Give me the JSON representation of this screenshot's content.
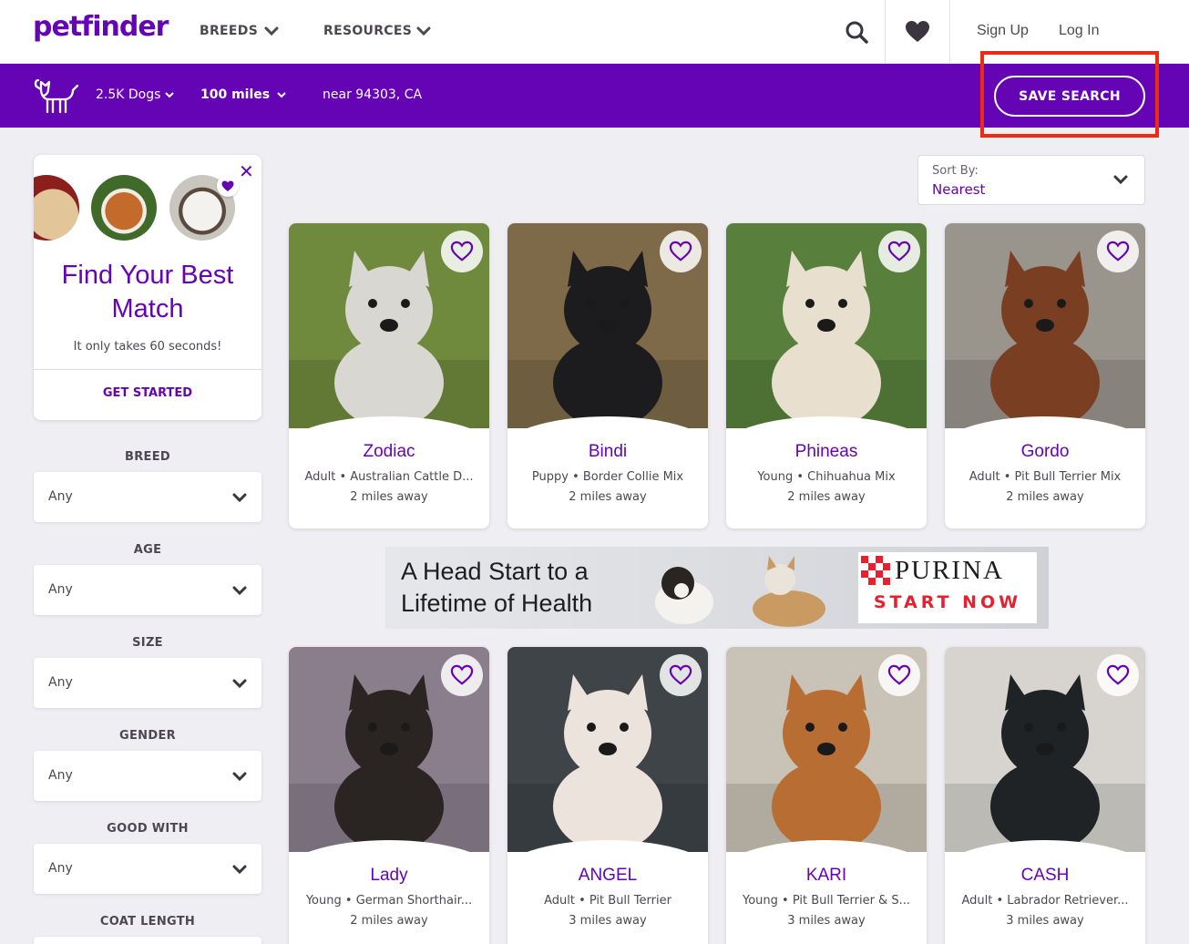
{
  "nav": {
    "logo": "petfinder",
    "breeds": "BREEDS",
    "resources": "RESOURCES",
    "signup": "Sign Up",
    "login": "Log In"
  },
  "searchbar": {
    "count": "2.5K Dogs",
    "distance": "100 miles",
    "location": "near 94303, CA",
    "save": "SAVE SEARCH"
  },
  "match": {
    "title_line1": "Find Your Best",
    "title_line2": "Match",
    "subtitle": "It only takes 60 seconds!",
    "cta": "GET STARTED"
  },
  "filters": [
    {
      "label": "BREED",
      "value": "Any"
    },
    {
      "label": "AGE",
      "value": "Any"
    },
    {
      "label": "SIZE",
      "value": "Any"
    },
    {
      "label": "GENDER",
      "value": "Any"
    },
    {
      "label": "GOOD WITH",
      "value": "Any"
    },
    {
      "label": "COAT LENGTH",
      "value": ""
    }
  ],
  "sort": {
    "label": "Sort By:",
    "value": "Nearest"
  },
  "pets": [
    {
      "name": "Zodiac",
      "age": "Adult",
      "breed": "Australian Cattle D...",
      "distance": "2 miles away",
      "bg": "#6f8a3c",
      "dog": "#d9d7d2"
    },
    {
      "name": "Bindi",
      "age": "Puppy",
      "breed": "Border Collie Mix",
      "distance": "2 miles away",
      "bg": "#7e6a48",
      "dog": "#1c1c1f"
    },
    {
      "name": "Phineas",
      "age": "Young",
      "breed": "Chihuahua Mix",
      "distance": "2 miles away",
      "bg": "#58803c",
      "dog": "#e8dfcf"
    },
    {
      "name": "Gordo",
      "age": "Adult",
      "breed": "Pit Bull Terrier Mix",
      "distance": "2 miles away",
      "bg": "#9a958c",
      "dog": "#7a3f22"
    },
    {
      "name": "Lady",
      "age": "Young",
      "breed": "German Shorthair...",
      "distance": "2 miles away",
      "bg": "#8a7e8c",
      "dog": "#2a2523"
    },
    {
      "name": "ANGEL",
      "age": "Adult",
      "breed": "Pit Bull Terrier",
      "distance": "3 miles away",
      "bg": "#3e4448",
      "dog": "#ece3dd"
    },
    {
      "name": "KARI",
      "age": "Young",
      "breed": "Pit Bull Terrier & S...",
      "distance": "3 miles away",
      "bg": "#c9c2b6",
      "dog": "#b86d33"
    },
    {
      "name": "CASH",
      "age": "Adult",
      "breed": "Labrador Retriever...",
      "distance": "3 miles away",
      "bg": "#d7d4cf",
      "dog": "#1f2326"
    }
  ],
  "ad": {
    "line1": "A Head Start to a",
    "line2": "Lifetime of Health",
    "brand": "PURINA",
    "cta": "START NOW"
  },
  "colors": {
    "brand": "#6504b5",
    "highlight": "#ee2a12",
    "background": "#eeeef3"
  }
}
